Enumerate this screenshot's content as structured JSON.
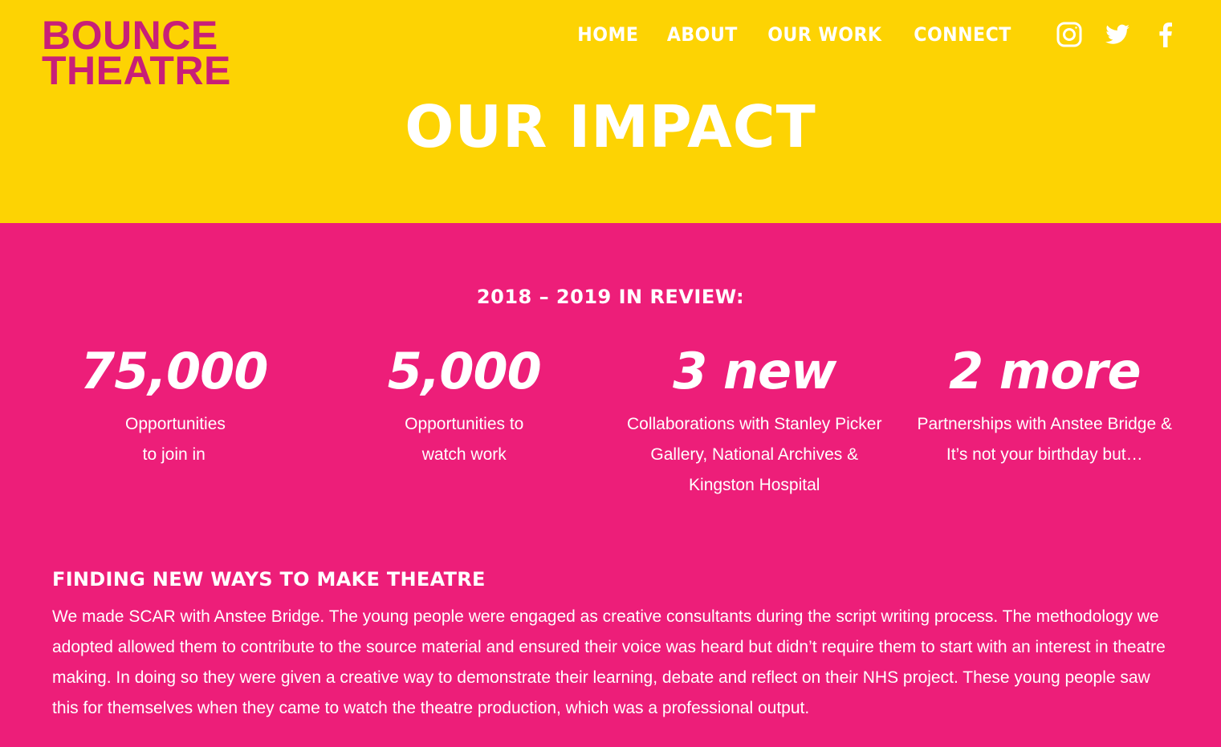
{
  "brand": {
    "line1": "BOUNCE",
    "line2": "THEATRE",
    "color": "#c81f78"
  },
  "nav": {
    "items": [
      {
        "label": "HOME"
      },
      {
        "label": "ABOUT"
      },
      {
        "label": "OUR WORK"
      },
      {
        "label": "CONNECT"
      }
    ],
    "social": [
      "instagram-icon",
      "twitter-icon",
      "facebook-icon"
    ]
  },
  "hero": {
    "title": "OUR IMPACT",
    "background": "#fdd303"
  },
  "review": {
    "heading": "2018 – 2019 IN REVIEW:",
    "background": "#ed1e79",
    "stats": [
      {
        "value": "75,000",
        "desc": "Opportunities to join in"
      },
      {
        "value": "5,000",
        "desc": "Opportunities to watch work"
      },
      {
        "value": "3 new",
        "desc": "Collaborations with Stanley Picker Gallery, National Archives & Kingston Hospital"
      },
      {
        "value": "2 more",
        "desc": "Partnerships with Anstee Bridge & It’s not your birthday but…"
      }
    ]
  },
  "section": {
    "heading": "FINDING NEW WAYS TO MAKE THEATRE",
    "body": "We made SCAR with Anstee Bridge. The young people were engaged as creative consultants during the script writing process. The methodology we adopted allowed them to contribute to the source material and ensured their voice was heard but didn’t require them to start with an interest in theatre making. In doing so they were given a creative way to demonstrate their learning, debate and reflect on their NHS project. These young people saw this for themselves when they came to watch the theatre production, which was a professional output."
  }
}
